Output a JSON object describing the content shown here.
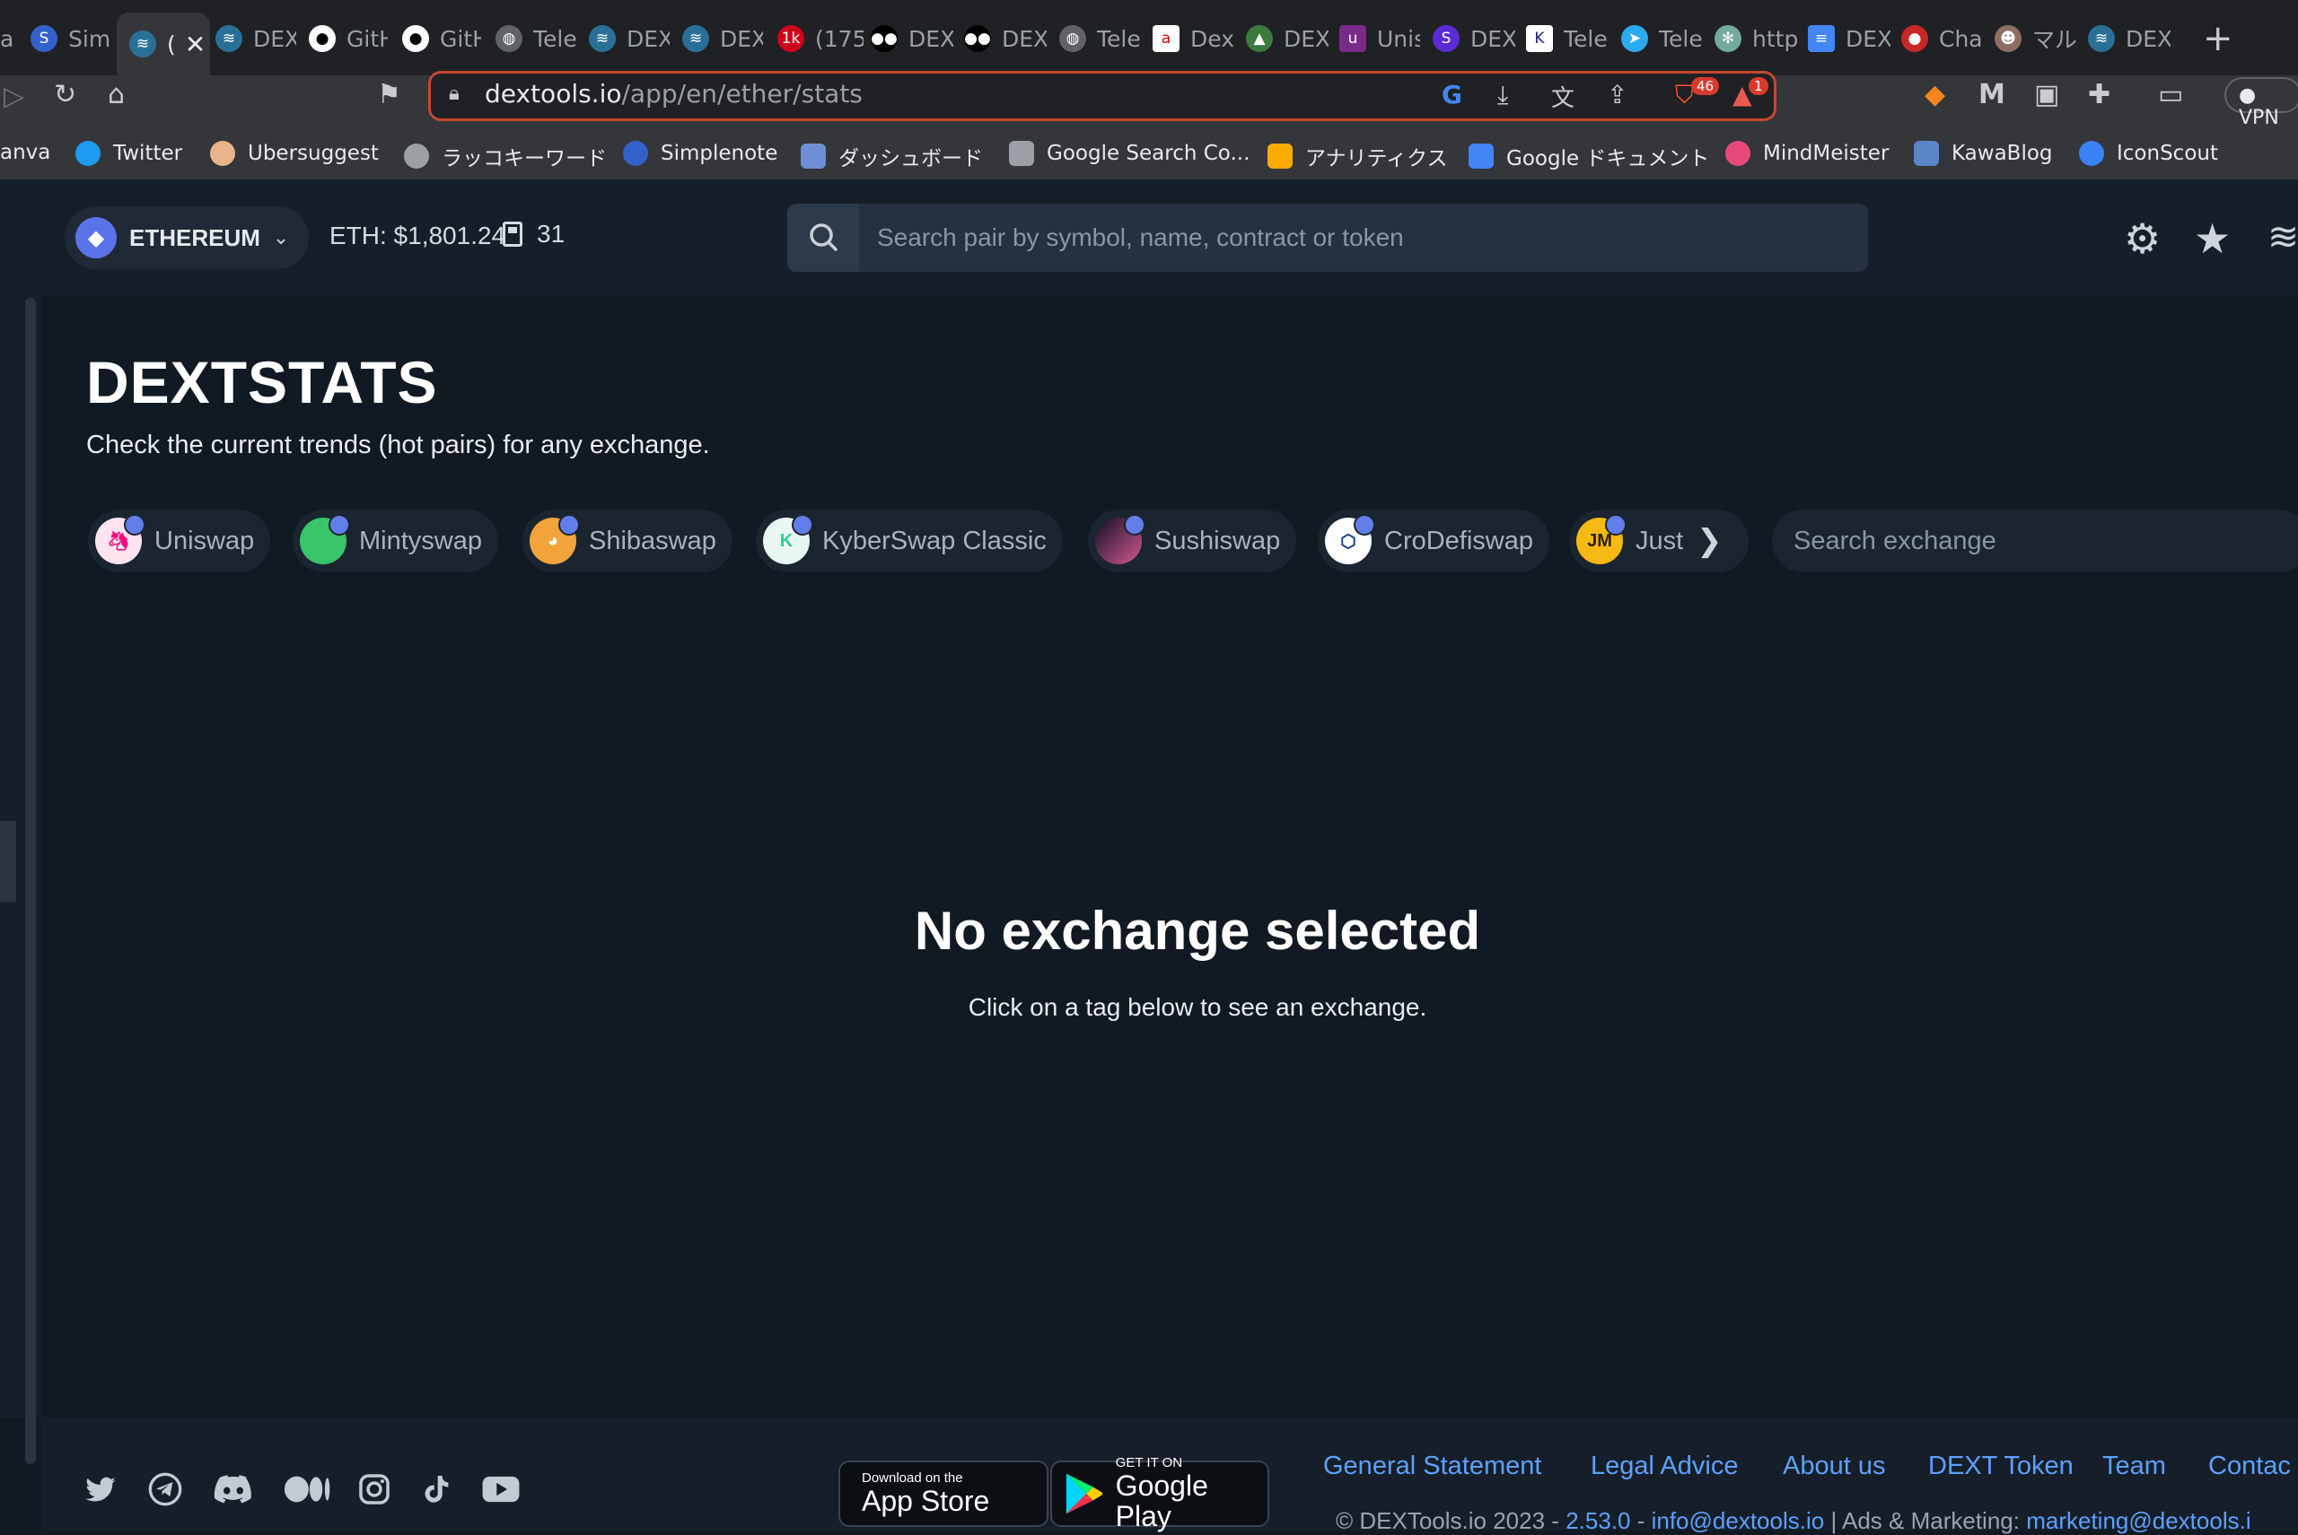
{
  "browser": {
    "tabs": [
      {
        "label": "a",
        "icon": "partial-icon"
      },
      {
        "label": "Sim",
        "icon": "simplenote-icon"
      },
      {
        "label": "(",
        "icon": "dextools-icon",
        "active": true
      },
      {
        "label": "DEX",
        "icon": "dextools-icon"
      },
      {
        "label": "GitH",
        "icon": "github-icon"
      },
      {
        "label": "GitH",
        "icon": "github-icon"
      },
      {
        "label": "Tele",
        "icon": "globe-icon"
      },
      {
        "label": "DEX",
        "icon": "dextools-icon"
      },
      {
        "label": "DEX",
        "icon": "dextools-icon"
      },
      {
        "label": "(175",
        "icon": "badge-1k-icon"
      },
      {
        "label": "DEX",
        "icon": "medium-icon"
      },
      {
        "label": "DEX",
        "icon": "medium-icon"
      },
      {
        "label": "Tele",
        "icon": "globe-icon"
      },
      {
        "label": "Dex",
        "icon": "a2c-icon"
      },
      {
        "label": "DEX",
        "icon": "frog-icon"
      },
      {
        "label": "Unis",
        "icon": "uniswap-icon"
      },
      {
        "label": "DEX",
        "icon": "purple-s-icon"
      },
      {
        "label": "Tele",
        "icon": "k-icon"
      },
      {
        "label": "Tele",
        "icon": "telegram-icon"
      },
      {
        "label": "http",
        "icon": "chatgpt-icon"
      },
      {
        "label": "DEX",
        "icon": "docs-icon"
      },
      {
        "label": "Cha",
        "icon": "cherry-icon"
      },
      {
        "label": "マル",
        "icon": "character-icon"
      },
      {
        "label": "DEX",
        "icon": "dextools-icon"
      }
    ],
    "url_host": "dextools.io",
    "url_path": "/app/en/ether/stats",
    "brave_badge": "46",
    "alert_badge": "1",
    "vpn_label": "VPN",
    "bookmarks": [
      {
        "label": "anva",
        "color": "#00c4cc"
      },
      {
        "label": "Twitter",
        "color": "#1d9bf0"
      },
      {
        "label": "Ubersuggest",
        "color": "#e8b48a"
      },
      {
        "label": "ラッコキーワード",
        "color": "#9aa0a6"
      },
      {
        "label": "Simplenote",
        "color": "#3361cc"
      },
      {
        "label": "ダッシュボード",
        "color": "#6e8fd6"
      },
      {
        "label": "Google Search Co...",
        "color": "#9aa0a6"
      },
      {
        "label": "アナリティクス",
        "color": "#f9ab00"
      },
      {
        "label": "Google ドキュメント",
        "color": "#4285f4"
      },
      {
        "label": "MindMeister",
        "color": "#e6497a"
      },
      {
        "label": "KawaBlog",
        "color": "#5b86c9"
      },
      {
        "label": "IconScout",
        "color": "#3b82f6"
      }
    ]
  },
  "header": {
    "chain": "ETHEREUM",
    "eth_price": "ETH: $1,801.24",
    "gas": "31",
    "search_placeholder": "Search pair by symbol, name, contract or token"
  },
  "main": {
    "title": "DEXTSTATS",
    "subtitle": "Check the current trends (hot pairs) for any exchange.",
    "exchanges": [
      {
        "name": "Uniswap",
        "color": "#ff007a"
      },
      {
        "name": "Mintyswap",
        "color": "#39c46a"
      },
      {
        "name": "Shibaswap",
        "color": "#f2a43a"
      },
      {
        "name": "KyberSwap Classic",
        "color": "#31cb9e"
      },
      {
        "name": "Sushiswap",
        "color": "#d65892"
      },
      {
        "name": "CroDefiswap",
        "color": "#1a3a8a"
      },
      {
        "name": "Just",
        "color": "#f5b914"
      }
    ],
    "exchange_search_placeholder": "Search exchange",
    "empty_title": "No exchange selected",
    "empty_subtitle": "Click on a tag below to see an exchange."
  },
  "footer": {
    "social_icons": [
      "twitter-icon",
      "telegram-icon",
      "discord-icon",
      "medium-icon",
      "instagram-icon",
      "tiktok-icon",
      "youtube-icon"
    ],
    "app_store_small": "Download on the",
    "app_store_big": "App Store",
    "google_play_small": "GET IT ON",
    "google_play_big": "Google Play",
    "links": [
      "General Statement",
      "Legal Advice",
      "About us",
      "DEXT Token",
      "Team",
      "Contac"
    ],
    "copyright_prefix": "© DEXTools.io 2023 -",
    "version": "2.53.0",
    "email": "info@dextools.io",
    "ads_label": "| Ads & Marketing:",
    "ads_email": "marketing@dextools.i"
  }
}
